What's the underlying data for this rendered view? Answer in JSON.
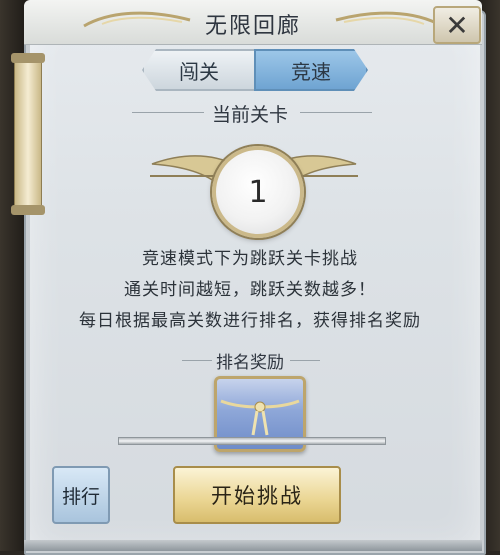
{
  "window": {
    "title": "无限回廊"
  },
  "tabs": [
    {
      "label": "闯关",
      "active": false
    },
    {
      "label": "竞速",
      "active": true
    }
  ],
  "current_level": {
    "heading": "当前关卡",
    "value": "1"
  },
  "description": [
    "竞速模式下为跳跃关卡挑战",
    "通关时间越短，跳跃关数越多！",
    "每日根据最高关数进行排名，获得排名奖励"
  ],
  "reward": {
    "heading": "排名奖励",
    "icon": "treasure-chest-icon"
  },
  "buttons": {
    "rank": "排行",
    "start": "开始挑战",
    "close": "✕"
  },
  "colors": {
    "active_tab": "#7fb2de",
    "start_button": "#ead592",
    "panel": "#dde2e6",
    "gold_trim": "#cbb98a"
  }
}
